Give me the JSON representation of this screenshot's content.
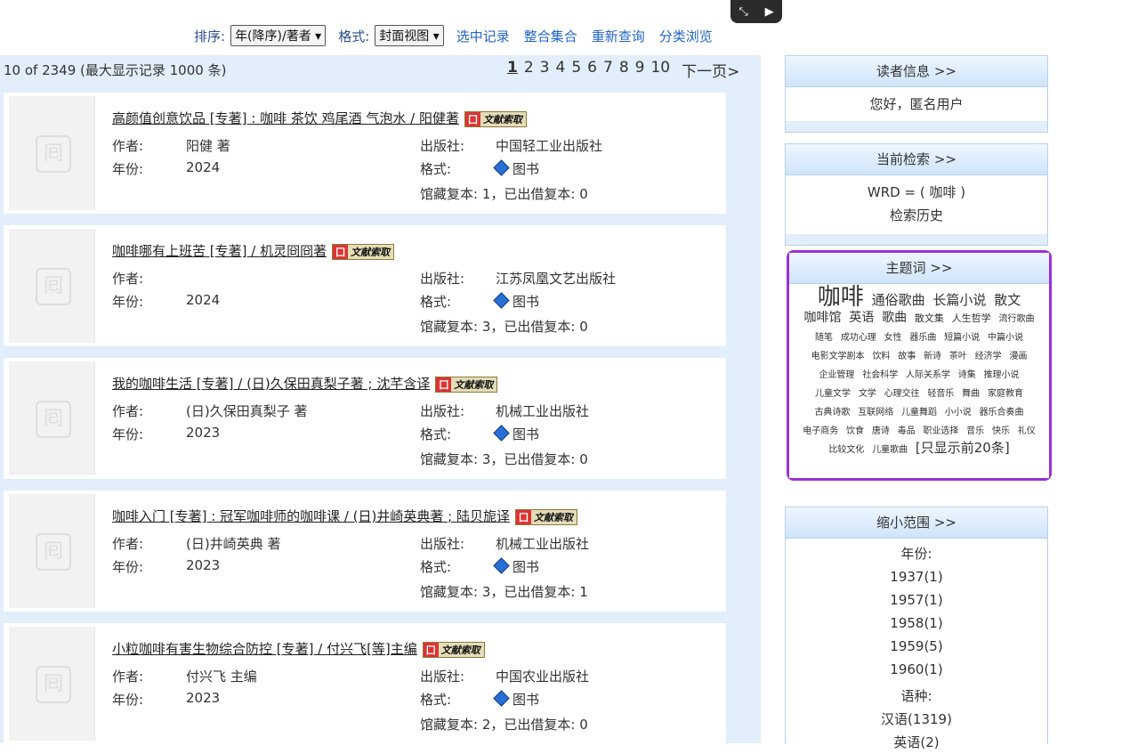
{
  "toolbar": {
    "sort_label": "排序:",
    "sort_value": "年(降序)/著者",
    "format_label": "格式:",
    "format_value": "封面视图",
    "link_selected": "选中记录",
    "link_merge": "整合集合",
    "link_requery": "重新查询",
    "link_browse": "分类浏览"
  },
  "results": {
    "summary": "10 of 2349 (最大显示记录 1000 条)",
    "pages": [
      "1",
      "2",
      "3",
      "4",
      "5",
      "6",
      "7",
      "8",
      "9",
      "10"
    ],
    "next": "下一页>"
  },
  "labels": {
    "author": "作者:",
    "year": "年份:",
    "publisher": "出版社:",
    "format": "格式:",
    "fetch": "文献索取"
  },
  "records": [
    {
      "title": "高颜值创意饮品 [专著] : 咖啡 茶饮 鸡尾酒 气泡水 / 阳健著",
      "author": "阳健 著",
      "year": "2024",
      "publisher": "中国轻工业出版社",
      "format": "图书",
      "holdings": "馆藏复本: 1，已出借复本: 0"
    },
    {
      "title": "咖啡哪有上班苦 [专著] / 机灵冏冏著",
      "author": "",
      "year": "2024",
      "publisher": "江苏凤凰文艺出版社",
      "format": "图书",
      "holdings": "馆藏复本: 3，已出借复本: 0"
    },
    {
      "title": "我的咖啡生活 [专著] / (日)久保田真梨子著 ; 沈芊含译",
      "author": "(日)久保田真梨子 著",
      "year": "2023",
      "publisher": "机械工业出版社",
      "format": "图书",
      "holdings": "馆藏复本: 3，已出借复本: 0"
    },
    {
      "title": "咖啡入门 [专著] : 冠军咖啡师的咖啡课 / (日)井崎英典著 ; 陆贝旎译",
      "author": "(日)井崎英典 著",
      "year": "2023",
      "publisher": "机械工业出版社",
      "format": "图书",
      "holdings": "馆藏复本: 3，已出借复本: 1"
    },
    {
      "title": "小粒咖啡有害生物综合防控 [专著] / 付兴飞[等]主编",
      "author": "付兴飞 主编",
      "year": "2023",
      "publisher": "中国农业出版社",
      "format": "图书",
      "holdings": "馆藏复本: 2，已出借复本: 0"
    }
  ],
  "sidebar": {
    "reader_header": "读者信息 >>",
    "reader_greeting": "您好，匿名用户",
    "search_header": "当前检索 >>",
    "search_query": "WRD = ( 咖啡 )",
    "search_history": "检索历史",
    "subject_header": "主题词 >>",
    "subject_terms": [
      {
        "t": "咖啡",
        "s": 26
      },
      {
        "t": "通俗歌曲",
        "s": 15
      },
      {
        "t": "长篇小说",
        "s": 15
      },
      {
        "t": "散文",
        "s": 15
      },
      {
        "t": "咖啡馆",
        "s": 14
      },
      {
        "t": "英语",
        "s": 14
      },
      {
        "t": "歌曲",
        "s": 14
      },
      {
        "t": "散文集",
        "s": 11
      },
      {
        "t": "人生哲学",
        "s": 11
      },
      {
        "t": "流行歌曲",
        "s": 10
      },
      {
        "t": "随笔",
        "s": 10
      },
      {
        "t": "成功心理",
        "s": 10
      },
      {
        "t": "女性",
        "s": 10
      },
      {
        "t": "器乐曲",
        "s": 10
      },
      {
        "t": "短篇小说",
        "s": 10
      },
      {
        "t": "中篇小说",
        "s": 10
      },
      {
        "t": "电影文学剧本",
        "s": 10
      },
      {
        "t": "饮料",
        "s": 10
      },
      {
        "t": "故事",
        "s": 10
      },
      {
        "t": "新诗",
        "s": 10
      },
      {
        "t": "茶叶",
        "s": 10
      },
      {
        "t": "经济学",
        "s": 10
      },
      {
        "t": "漫画",
        "s": 10
      },
      {
        "t": "企业管理",
        "s": 10
      },
      {
        "t": "社会科学",
        "s": 10
      },
      {
        "t": "人际关系学",
        "s": 10
      },
      {
        "t": "诗集",
        "s": 10
      },
      {
        "t": "推理小说",
        "s": 10
      },
      {
        "t": "儿童文学",
        "s": 10
      },
      {
        "t": "文学",
        "s": 10
      },
      {
        "t": "心理交往",
        "s": 10
      },
      {
        "t": "轻音乐",
        "s": 10
      },
      {
        "t": "舞曲",
        "s": 10
      },
      {
        "t": "家庭教育",
        "s": 10
      },
      {
        "t": "古典诗歌",
        "s": 10
      },
      {
        "t": "互联网络",
        "s": 10
      },
      {
        "t": "儿童舞蹈",
        "s": 10
      },
      {
        "t": "小小说",
        "s": 10
      },
      {
        "t": "器乐合奏曲",
        "s": 10
      },
      {
        "t": "电子商务",
        "s": 10
      },
      {
        "t": "饮食",
        "s": 10
      },
      {
        "t": "唐诗",
        "s": 10
      },
      {
        "t": "毒品",
        "s": 10
      },
      {
        "t": "职业选择",
        "s": 10
      },
      {
        "t": "音乐",
        "s": 10
      },
      {
        "t": "快乐",
        "s": 10
      },
      {
        "t": "礼仪",
        "s": 10
      },
      {
        "t": "比较文化",
        "s": 10
      },
      {
        "t": "儿童歌曲",
        "s": 10
      }
    ],
    "subject_more": "[只显示前20条]",
    "narrow_header": "缩小范围 >>",
    "year_label": "年份:",
    "years": [
      "1937(1)",
      "1957(1)",
      "1958(1)",
      "1959(5)",
      "1960(1)"
    ],
    "lang_label": "语种:",
    "languages": [
      "汉语(1319)",
      "英语(2)"
    ]
  }
}
